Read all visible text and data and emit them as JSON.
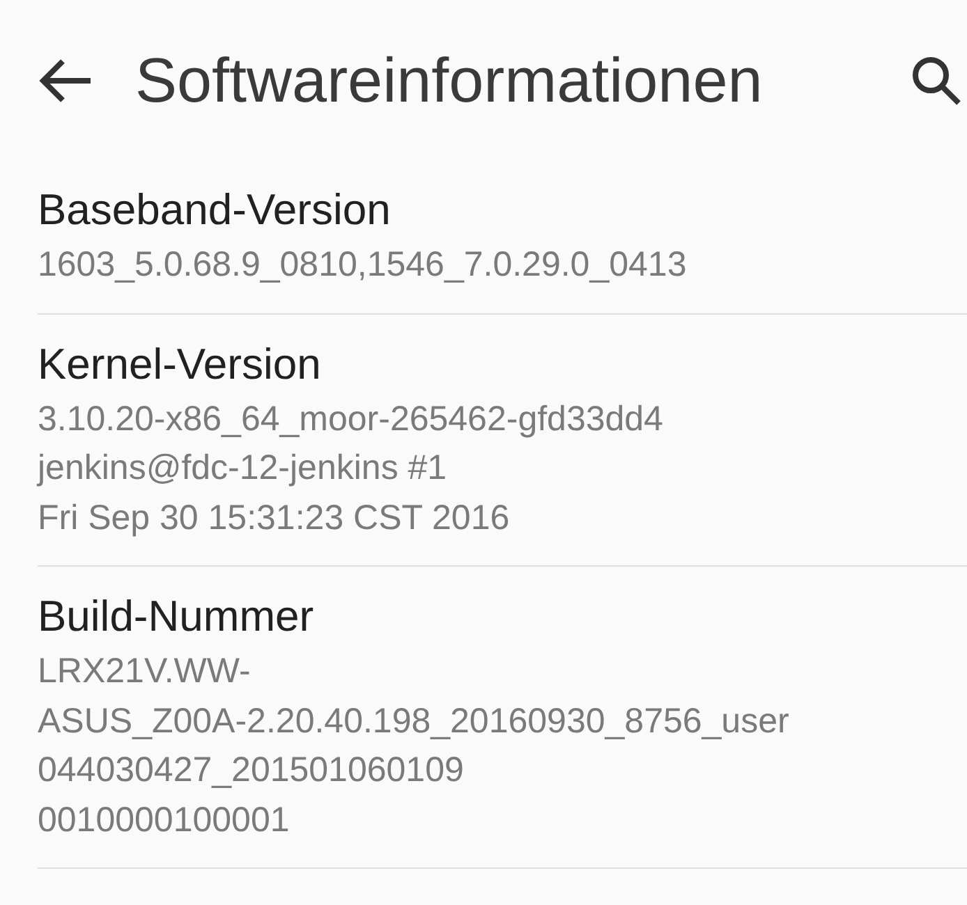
{
  "toolbar": {
    "title": "Softwareinformationen"
  },
  "items": [
    {
      "title": "Baseband-Version",
      "lines": [
        "1603_5.0.68.9_0810,1546_7.0.29.0_0413"
      ]
    },
    {
      "title": "Kernel-Version",
      "lines": [
        "3.10.20-x86_64_moor-265462-gfd33dd4",
        "jenkins@fdc-12-jenkins #1",
        "Fri Sep 30 15:31:23 CST 2016"
      ]
    },
    {
      "title": "Build-Nummer",
      "lines": [
        "LRX21V.WW-",
        "ASUS_Z00A-2.20.40.198_20160930_8756_user",
        "044030427_201501060109",
        "0010000100001"
      ]
    }
  ]
}
